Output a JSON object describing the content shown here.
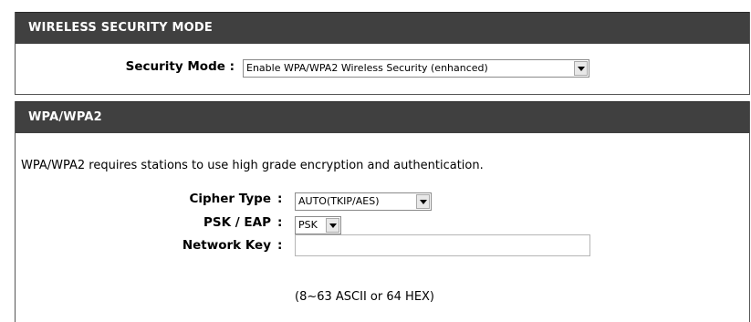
{
  "security_mode_section": {
    "title": "WIRELESS SECURITY MODE",
    "security_mode_label": "Security Mode :",
    "security_mode_value": "Enable WPA/WPA2 Wireless Security (enhanced)"
  },
  "wpa_section": {
    "title": "WPA/WPA2",
    "description": "WPA/WPA2 requires stations to use high grade encryption and authentication.",
    "cipher_type_label": "Cipher Type",
    "cipher_type_value": "AUTO(TKIP/AES)",
    "psk_eap_label": "PSK / EAP",
    "psk_eap_value": "PSK",
    "network_key_label": "Network Key",
    "network_key_value": "",
    "network_key_hint": "(8~63 ASCII or 64 HEX)",
    "colon": ":"
  }
}
